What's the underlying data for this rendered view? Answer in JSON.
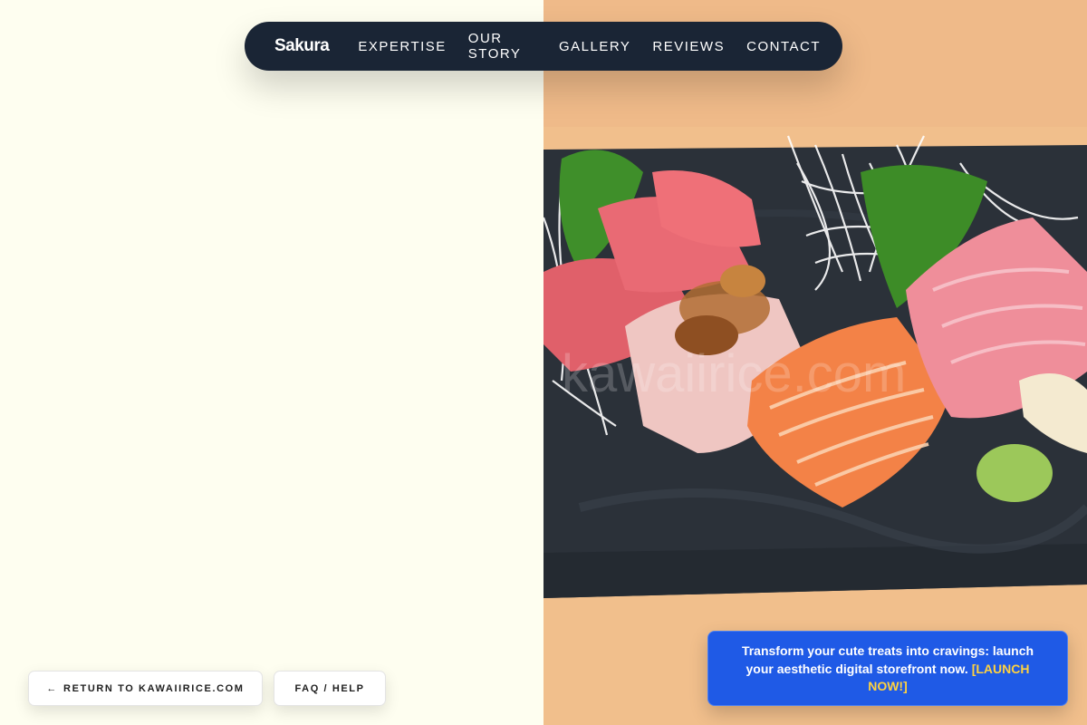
{
  "nav": {
    "brand": "Sakura",
    "links": [
      {
        "label": "EXPERTISE"
      },
      {
        "label": "OUR STORY"
      },
      {
        "label": "GALLERY"
      },
      {
        "label": "REVIEWS"
      },
      {
        "label": "CONTACT"
      }
    ]
  },
  "hero_image": {
    "subject": "sashimi platter on slate board",
    "watermark": "kawaiirice.com"
  },
  "footer": {
    "return_arrow": "←",
    "return_label": "RETURN TO KAWAIIRICE.COM",
    "faq_label": "FAQ / HELP"
  },
  "promo": {
    "text": "Transform your cute treats into cravings: launch your aesthetic digital storefront now.",
    "cta": "[LAUNCH NOW!]"
  },
  "colors": {
    "left_background": "#fefef0",
    "nav_background": "#1a2535",
    "promo_background": "#1f5ae6",
    "promo_cta": "#ffd23f",
    "table_wood": "#f1bf8c",
    "slate": "#2a3038"
  }
}
